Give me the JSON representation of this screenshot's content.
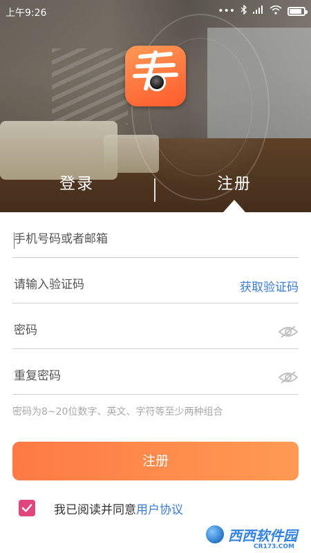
{
  "status_bar": {
    "time": "上午9:26",
    "signal": "•••",
    "battery_percent": 85
  },
  "tabs": {
    "login": "登录",
    "register": "注册",
    "active": "register"
  },
  "form": {
    "phone_placeholder": "手机号码或者邮箱",
    "code_placeholder": "请输入验证码",
    "get_code_label": "获取验证码",
    "password_placeholder": "密码",
    "confirm_password_placeholder": "重复密码",
    "password_hint": "密码为8~20位数字、英文、字符等至少两种组合"
  },
  "submit": {
    "label": "注册"
  },
  "agreement": {
    "checked": true,
    "text": "我已阅读并同意",
    "link": "用户协议"
  },
  "icons": {
    "logo": "camera-app-logo",
    "password_visibility": "eye-hidden-icon",
    "checkbox": "checkmark-icon"
  },
  "watermark": {
    "text": "西西软件园",
    "sub": "CR173.COM"
  },
  "colors": {
    "accent_orange": "#ff7a45",
    "link_blue": "#3a7bd5",
    "checkbox_pink": "#e0457b"
  }
}
